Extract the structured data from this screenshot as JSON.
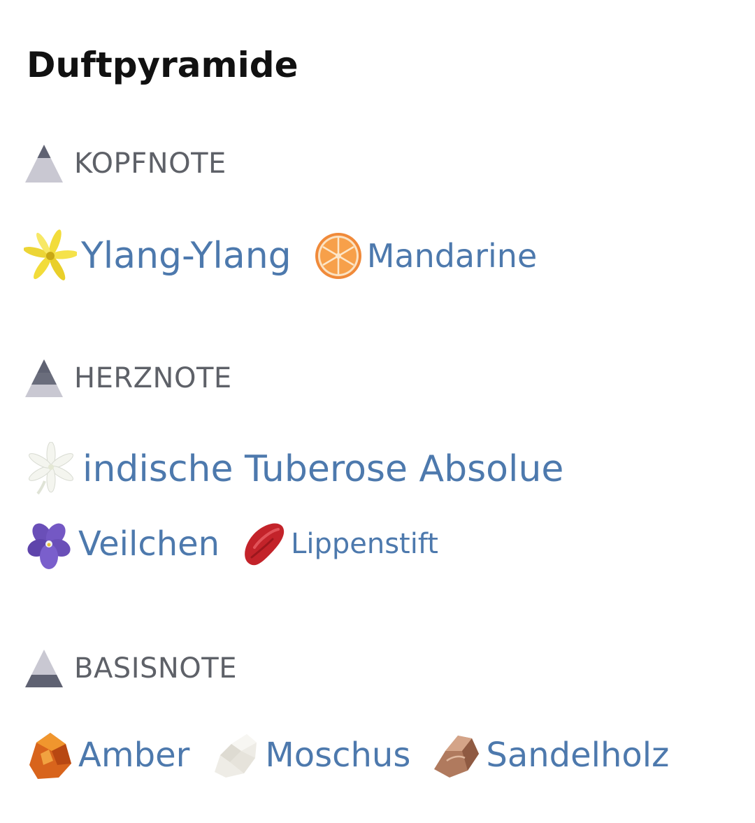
{
  "title": "Duftpyramide",
  "colors": {
    "link": "#4d79ad",
    "section_label": "#5e6168",
    "title": "#111111"
  },
  "sections": [
    {
      "label": "KOPFNOTE",
      "level_icon": "pyramid-top-icon",
      "notes": [
        {
          "label": "Ylang-Ylang",
          "icon": "ylang-ylang-flower-icon"
        },
        {
          "label": "Mandarine",
          "icon": "mandarin-slice-icon"
        }
      ]
    },
    {
      "label": "HERZNOTE",
      "level_icon": "pyramid-middle-icon",
      "notes": [
        {
          "label": "indische Tuberose Absolue",
          "icon": "tuberose-flower-icon"
        },
        {
          "label": "Veilchen",
          "icon": "violet-flower-icon"
        },
        {
          "label": "Lippenstift",
          "icon": "lipstick-smear-icon"
        }
      ]
    },
    {
      "label": "BASISNOTE",
      "level_icon": "pyramid-base-icon",
      "notes": [
        {
          "label": "Amber",
          "icon": "amber-stone-icon"
        },
        {
          "label": "Moschus",
          "icon": "musk-crystal-icon"
        },
        {
          "label": "Sandelholz",
          "icon": "sandalwood-piece-icon"
        }
      ]
    }
  ]
}
